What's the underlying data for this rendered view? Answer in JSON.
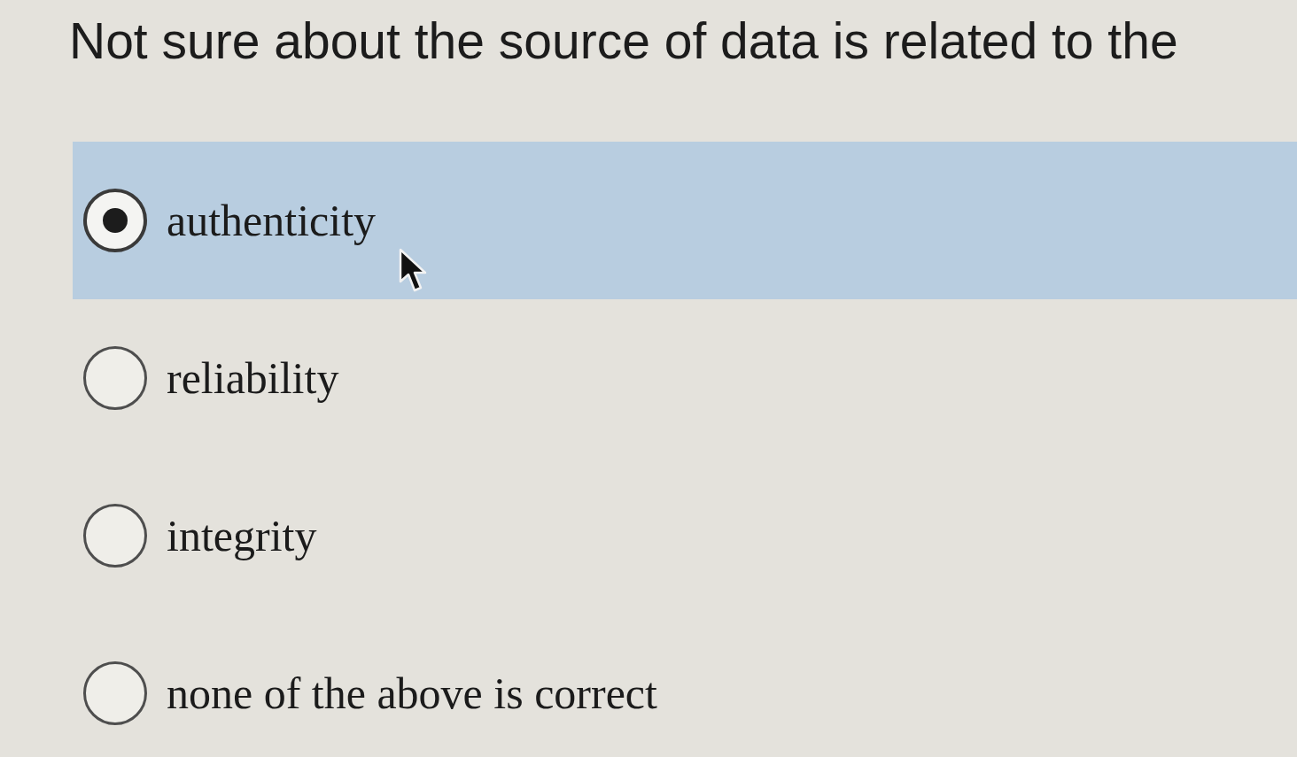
{
  "question": {
    "text": "Not sure about the source of data is related to the"
  },
  "options": [
    {
      "label": "authenticity",
      "selected": true
    },
    {
      "label": "reliability",
      "selected": false
    },
    {
      "label": "integrity",
      "selected": false
    },
    {
      "label": "none of the above is correct",
      "selected": false
    }
  ]
}
